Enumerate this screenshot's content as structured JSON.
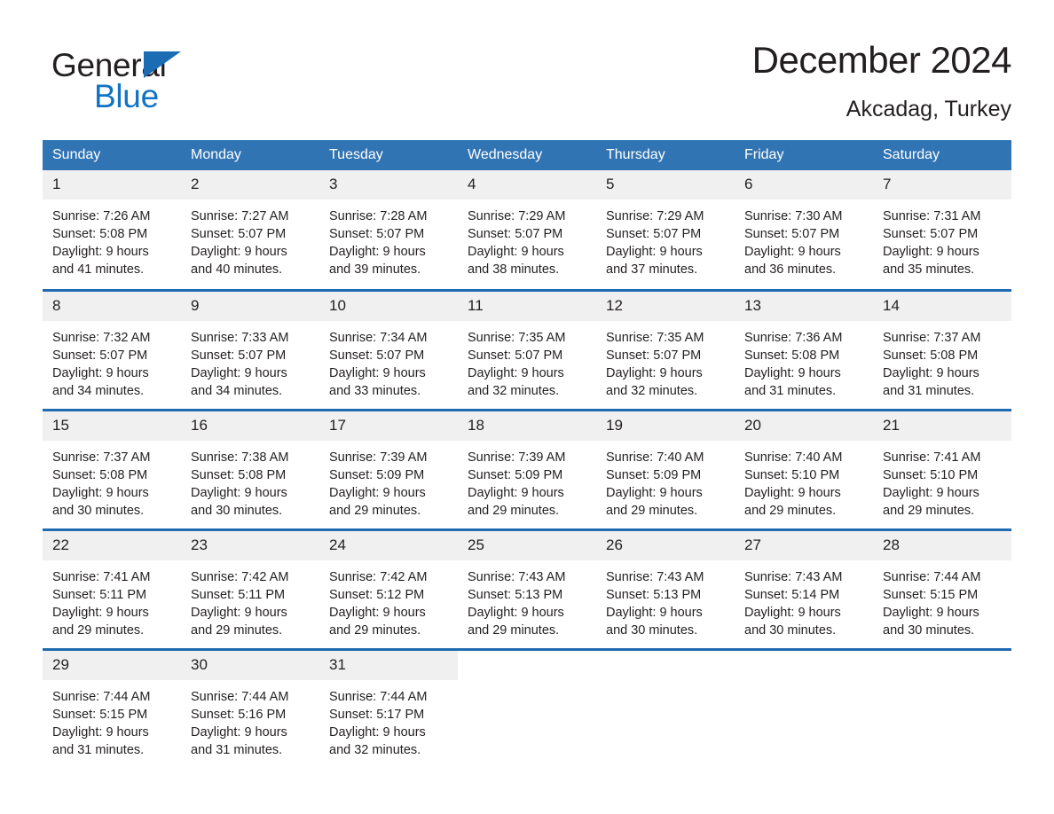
{
  "brand": {
    "name_part1": "General",
    "name_part2": "Blue",
    "triangle_color": "#1b6cb3",
    "blue_color": "#1273c4"
  },
  "header": {
    "title": "December 2024",
    "location": "Akcadag, Turkey"
  },
  "colors": {
    "header_row": "#3174b4",
    "week_divider": "#1f6ab0",
    "daynum_band": "#f0f0f0",
    "text": "#231f20"
  },
  "weekdays": [
    "Sunday",
    "Monday",
    "Tuesday",
    "Wednesday",
    "Thursday",
    "Friday",
    "Saturday"
  ],
  "weeks": [
    [
      {
        "day": "1",
        "sunrise": "Sunrise: 7:26 AM",
        "sunset": "Sunset: 5:08 PM",
        "daylight1": "Daylight: 9 hours",
        "daylight2": "and 41 minutes."
      },
      {
        "day": "2",
        "sunrise": "Sunrise: 7:27 AM",
        "sunset": "Sunset: 5:07 PM",
        "daylight1": "Daylight: 9 hours",
        "daylight2": "and 40 minutes."
      },
      {
        "day": "3",
        "sunrise": "Sunrise: 7:28 AM",
        "sunset": "Sunset: 5:07 PM",
        "daylight1": "Daylight: 9 hours",
        "daylight2": "and 39 minutes."
      },
      {
        "day": "4",
        "sunrise": "Sunrise: 7:29 AM",
        "sunset": "Sunset: 5:07 PM",
        "daylight1": "Daylight: 9 hours",
        "daylight2": "and 38 minutes."
      },
      {
        "day": "5",
        "sunrise": "Sunrise: 7:29 AM",
        "sunset": "Sunset: 5:07 PM",
        "daylight1": "Daylight: 9 hours",
        "daylight2": "and 37 minutes."
      },
      {
        "day": "6",
        "sunrise": "Sunrise: 7:30 AM",
        "sunset": "Sunset: 5:07 PM",
        "daylight1": "Daylight: 9 hours",
        "daylight2": "and 36 minutes."
      },
      {
        "day": "7",
        "sunrise": "Sunrise: 7:31 AM",
        "sunset": "Sunset: 5:07 PM",
        "daylight1": "Daylight: 9 hours",
        "daylight2": "and 35 minutes."
      }
    ],
    [
      {
        "day": "8",
        "sunrise": "Sunrise: 7:32 AM",
        "sunset": "Sunset: 5:07 PM",
        "daylight1": "Daylight: 9 hours",
        "daylight2": "and 34 minutes."
      },
      {
        "day": "9",
        "sunrise": "Sunrise: 7:33 AM",
        "sunset": "Sunset: 5:07 PM",
        "daylight1": "Daylight: 9 hours",
        "daylight2": "and 34 minutes."
      },
      {
        "day": "10",
        "sunrise": "Sunrise: 7:34 AM",
        "sunset": "Sunset: 5:07 PM",
        "daylight1": "Daylight: 9 hours",
        "daylight2": "and 33 minutes."
      },
      {
        "day": "11",
        "sunrise": "Sunrise: 7:35 AM",
        "sunset": "Sunset: 5:07 PM",
        "daylight1": "Daylight: 9 hours",
        "daylight2": "and 32 minutes."
      },
      {
        "day": "12",
        "sunrise": "Sunrise: 7:35 AM",
        "sunset": "Sunset: 5:07 PM",
        "daylight1": "Daylight: 9 hours",
        "daylight2": "and 32 minutes."
      },
      {
        "day": "13",
        "sunrise": "Sunrise: 7:36 AM",
        "sunset": "Sunset: 5:08 PM",
        "daylight1": "Daylight: 9 hours",
        "daylight2": "and 31 minutes."
      },
      {
        "day": "14",
        "sunrise": "Sunrise: 7:37 AM",
        "sunset": "Sunset: 5:08 PM",
        "daylight1": "Daylight: 9 hours",
        "daylight2": "and 31 minutes."
      }
    ],
    [
      {
        "day": "15",
        "sunrise": "Sunrise: 7:37 AM",
        "sunset": "Sunset: 5:08 PM",
        "daylight1": "Daylight: 9 hours",
        "daylight2": "and 30 minutes."
      },
      {
        "day": "16",
        "sunrise": "Sunrise: 7:38 AM",
        "sunset": "Sunset: 5:08 PM",
        "daylight1": "Daylight: 9 hours",
        "daylight2": "and 30 minutes."
      },
      {
        "day": "17",
        "sunrise": "Sunrise: 7:39 AM",
        "sunset": "Sunset: 5:09 PM",
        "daylight1": "Daylight: 9 hours",
        "daylight2": "and 29 minutes."
      },
      {
        "day": "18",
        "sunrise": "Sunrise: 7:39 AM",
        "sunset": "Sunset: 5:09 PM",
        "daylight1": "Daylight: 9 hours",
        "daylight2": "and 29 minutes."
      },
      {
        "day": "19",
        "sunrise": "Sunrise: 7:40 AM",
        "sunset": "Sunset: 5:09 PM",
        "daylight1": "Daylight: 9 hours",
        "daylight2": "and 29 minutes."
      },
      {
        "day": "20",
        "sunrise": "Sunrise: 7:40 AM",
        "sunset": "Sunset: 5:10 PM",
        "daylight1": "Daylight: 9 hours",
        "daylight2": "and 29 minutes."
      },
      {
        "day": "21",
        "sunrise": "Sunrise: 7:41 AM",
        "sunset": "Sunset: 5:10 PM",
        "daylight1": "Daylight: 9 hours",
        "daylight2": "and 29 minutes."
      }
    ],
    [
      {
        "day": "22",
        "sunrise": "Sunrise: 7:41 AM",
        "sunset": "Sunset: 5:11 PM",
        "daylight1": "Daylight: 9 hours",
        "daylight2": "and 29 minutes."
      },
      {
        "day": "23",
        "sunrise": "Sunrise: 7:42 AM",
        "sunset": "Sunset: 5:11 PM",
        "daylight1": "Daylight: 9 hours",
        "daylight2": "and 29 minutes."
      },
      {
        "day": "24",
        "sunrise": "Sunrise: 7:42 AM",
        "sunset": "Sunset: 5:12 PM",
        "daylight1": "Daylight: 9 hours",
        "daylight2": "and 29 minutes."
      },
      {
        "day": "25",
        "sunrise": "Sunrise: 7:43 AM",
        "sunset": "Sunset: 5:13 PM",
        "daylight1": "Daylight: 9 hours",
        "daylight2": "and 29 minutes."
      },
      {
        "day": "26",
        "sunrise": "Sunrise: 7:43 AM",
        "sunset": "Sunset: 5:13 PM",
        "daylight1": "Daylight: 9 hours",
        "daylight2": "and 30 minutes."
      },
      {
        "day": "27",
        "sunrise": "Sunrise: 7:43 AM",
        "sunset": "Sunset: 5:14 PM",
        "daylight1": "Daylight: 9 hours",
        "daylight2": "and 30 minutes."
      },
      {
        "day": "28",
        "sunrise": "Sunrise: 7:44 AM",
        "sunset": "Sunset: 5:15 PM",
        "daylight1": "Daylight: 9 hours",
        "daylight2": "and 30 minutes."
      }
    ],
    [
      {
        "day": "29",
        "sunrise": "Sunrise: 7:44 AM",
        "sunset": "Sunset: 5:15 PM",
        "daylight1": "Daylight: 9 hours",
        "daylight2": "and 31 minutes."
      },
      {
        "day": "30",
        "sunrise": "Sunrise: 7:44 AM",
        "sunset": "Sunset: 5:16 PM",
        "daylight1": "Daylight: 9 hours",
        "daylight2": "and 31 minutes."
      },
      {
        "day": "31",
        "sunrise": "Sunrise: 7:44 AM",
        "sunset": "Sunset: 5:17 PM",
        "daylight1": "Daylight: 9 hours",
        "daylight2": "and 32 minutes."
      },
      {
        "day": "",
        "sunrise": "",
        "sunset": "",
        "daylight1": "",
        "daylight2": ""
      },
      {
        "day": "",
        "sunrise": "",
        "sunset": "",
        "daylight1": "",
        "daylight2": ""
      },
      {
        "day": "",
        "sunrise": "",
        "sunset": "",
        "daylight1": "",
        "daylight2": ""
      },
      {
        "day": "",
        "sunrise": "",
        "sunset": "",
        "daylight1": "",
        "daylight2": ""
      }
    ]
  ]
}
